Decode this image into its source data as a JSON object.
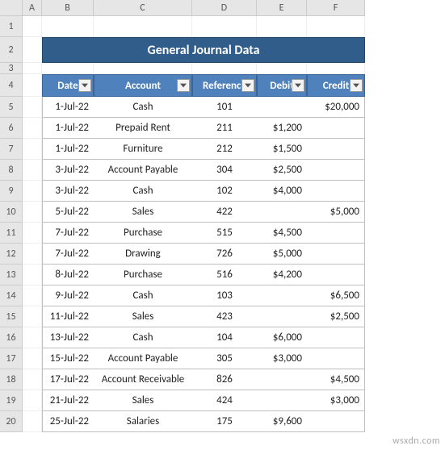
{
  "columns": [
    "A",
    "B",
    "C",
    "D",
    "E",
    "F"
  ],
  "row_numbers": [
    1,
    2,
    3,
    4,
    5,
    6,
    7,
    8,
    9,
    10,
    11,
    12,
    13,
    14,
    15,
    16,
    17,
    18,
    19,
    20
  ],
  "title": "General Journal Data",
  "headers": {
    "date": "Date",
    "account": "Account",
    "reference": "Reference",
    "debit": "Debit",
    "credit": "Credit"
  },
  "rows": [
    {
      "date": "1-Jul-22",
      "account": "Cash",
      "reference": "101",
      "debit": "",
      "credit": "$20,000"
    },
    {
      "date": "1-Jul-22",
      "account": "Prepaid Rent",
      "reference": "211",
      "debit": "$1,200",
      "credit": ""
    },
    {
      "date": "1-Jul-22",
      "account": "Furniture",
      "reference": "212",
      "debit": "$1,500",
      "credit": ""
    },
    {
      "date": "3-Jul-22",
      "account": "Account Payable",
      "reference": "304",
      "debit": "$2,500",
      "credit": ""
    },
    {
      "date": "3-Jul-22",
      "account": "Cash",
      "reference": "102",
      "debit": "$4,000",
      "credit": ""
    },
    {
      "date": "5-Jul-22",
      "account": "Sales",
      "reference": "422",
      "debit": "",
      "credit": "$5,000"
    },
    {
      "date": "7-Jul-22",
      "account": "Purchase",
      "reference": "515",
      "debit": "$4,500",
      "credit": ""
    },
    {
      "date": "7-Jul-22",
      "account": "Drawing",
      "reference": "726",
      "debit": "$5,000",
      "credit": ""
    },
    {
      "date": "8-Jul-22",
      "account": "Purchase",
      "reference": "516",
      "debit": "$4,200",
      "credit": ""
    },
    {
      "date": "9-Jul-22",
      "account": "Cash",
      "reference": "103",
      "debit": "",
      "credit": "$6,500"
    },
    {
      "date": "11-Jul-22",
      "account": "Sales",
      "reference": "423",
      "debit": "",
      "credit": "$2,500"
    },
    {
      "date": "13-Jul-22",
      "account": "Cash",
      "reference": "104",
      "debit": "$6,000",
      "credit": ""
    },
    {
      "date": "15-Jul-22",
      "account": "Account Payable",
      "reference": "305",
      "debit": "$3,000",
      "credit": ""
    },
    {
      "date": "17-Jul-22",
      "account": "Account Receivable",
      "reference": "826",
      "debit": "",
      "credit": "$4,500"
    },
    {
      "date": "21-Jul-22",
      "account": "Sales",
      "reference": "424",
      "debit": "",
      "credit": "$3,000"
    },
    {
      "date": "25-Jul-22",
      "account": "Salaries",
      "reference": "175",
      "debit": "$9,600",
      "credit": ""
    }
  ],
  "watermark": "wsxdn.com"
}
